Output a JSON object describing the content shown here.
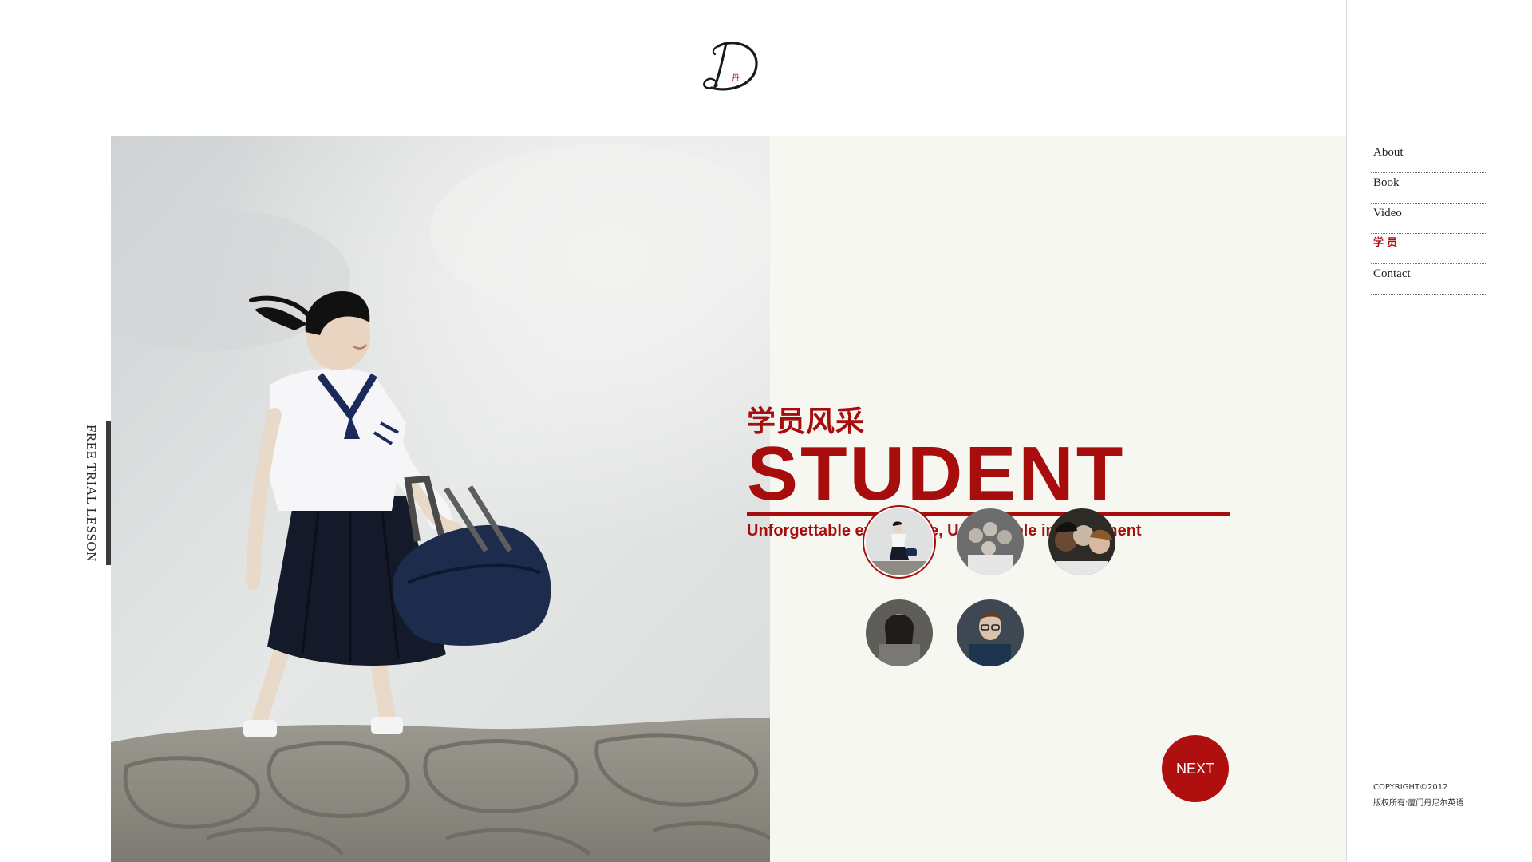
{
  "logo": {
    "alt": "D 丹"
  },
  "side_tab": {
    "label": "FREE TRIAL LESSON"
  },
  "headline": {
    "chinese_title": "学员风采",
    "english_title": "STUDENT",
    "tagline": "Unforgettable experience, Unblievable improvement"
  },
  "thumbnails": {
    "items": [
      {
        "name": "student-thumb-1",
        "active": true
      },
      {
        "name": "student-thumb-2",
        "active": false
      },
      {
        "name": "student-thumb-3",
        "active": false
      },
      {
        "name": "student-thumb-4",
        "active": false
      },
      {
        "name": "student-thumb-5",
        "active": false
      }
    ],
    "next_label": "NEXT"
  },
  "nav": {
    "items": [
      {
        "label": "About",
        "current": false
      },
      {
        "label": "Book",
        "current": false
      },
      {
        "label": "Video",
        "current": false
      },
      {
        "label": "学员",
        "current": true
      },
      {
        "label": "Contact",
        "current": false
      }
    ]
  },
  "footer": {
    "copyright": "COPYRIGHT©2012",
    "rights": "版权所有:厦门丹尼尔英语"
  },
  "colors": {
    "accent": "#a80d0d",
    "panel_background": "#f7f7f2",
    "page_background": "#ffffff"
  }
}
